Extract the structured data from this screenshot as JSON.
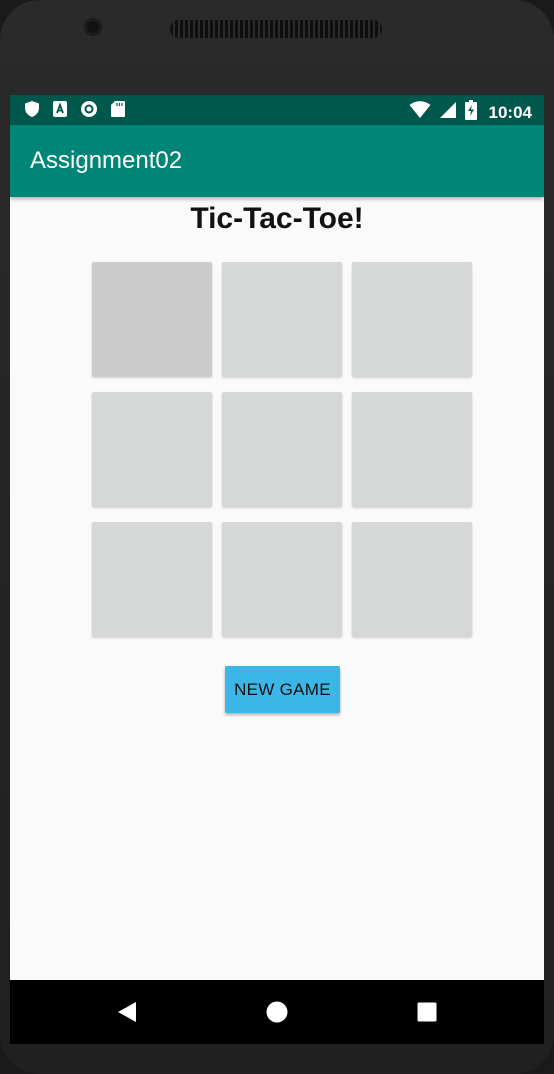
{
  "status_bar": {
    "time": "10:04",
    "left_icons": [
      "shield-icon",
      "a-notification-icon",
      "circle-notification-icon",
      "sd-card-icon"
    ],
    "right_icons": [
      "wifi-icon",
      "signal-icon",
      "battery-charging-icon"
    ]
  },
  "app_bar": {
    "title": "Assignment02",
    "color": "#008577"
  },
  "game": {
    "title": "Tic-Tac-Toe!",
    "cells": [
      "",
      "",
      "",
      "",
      "",
      "",
      "",
      "",
      ""
    ],
    "new_game_label": "NEW GAME",
    "button_color": "#3bb6e6"
  },
  "nav_bar": {
    "buttons": [
      "back-icon",
      "home-icon",
      "recents-icon"
    ]
  }
}
